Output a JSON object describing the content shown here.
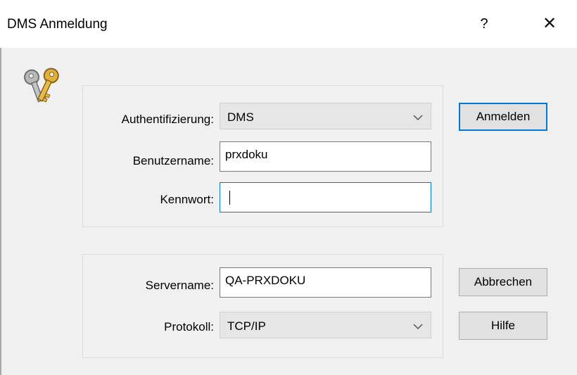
{
  "window": {
    "title": "DMS Anmeldung",
    "help_glyph": "?",
    "close_glyph": "✕"
  },
  "icons": {
    "app": "keys-icon",
    "dropdown": "chevron-down-icon"
  },
  "login_group": {
    "auth_label": "Authentifizierung:",
    "auth_value": "DMS",
    "username_label": "Benutzername:",
    "username_value": "prxdoku",
    "password_label": "Kennwort:",
    "password_value": ""
  },
  "server_group": {
    "servername_label": "Servername:",
    "servername_value": "QA-PRXDOKU",
    "protocol_label": "Protokoll:",
    "protocol_value": "TCP/IP"
  },
  "buttons": {
    "login": "Anmelden",
    "cancel": "Abbrechen",
    "help": "Hilfe"
  },
  "colors": {
    "focus_accent": "#0078d7",
    "window_bg": "#f0f0f0",
    "titlebar_bg": "#ffffff"
  }
}
